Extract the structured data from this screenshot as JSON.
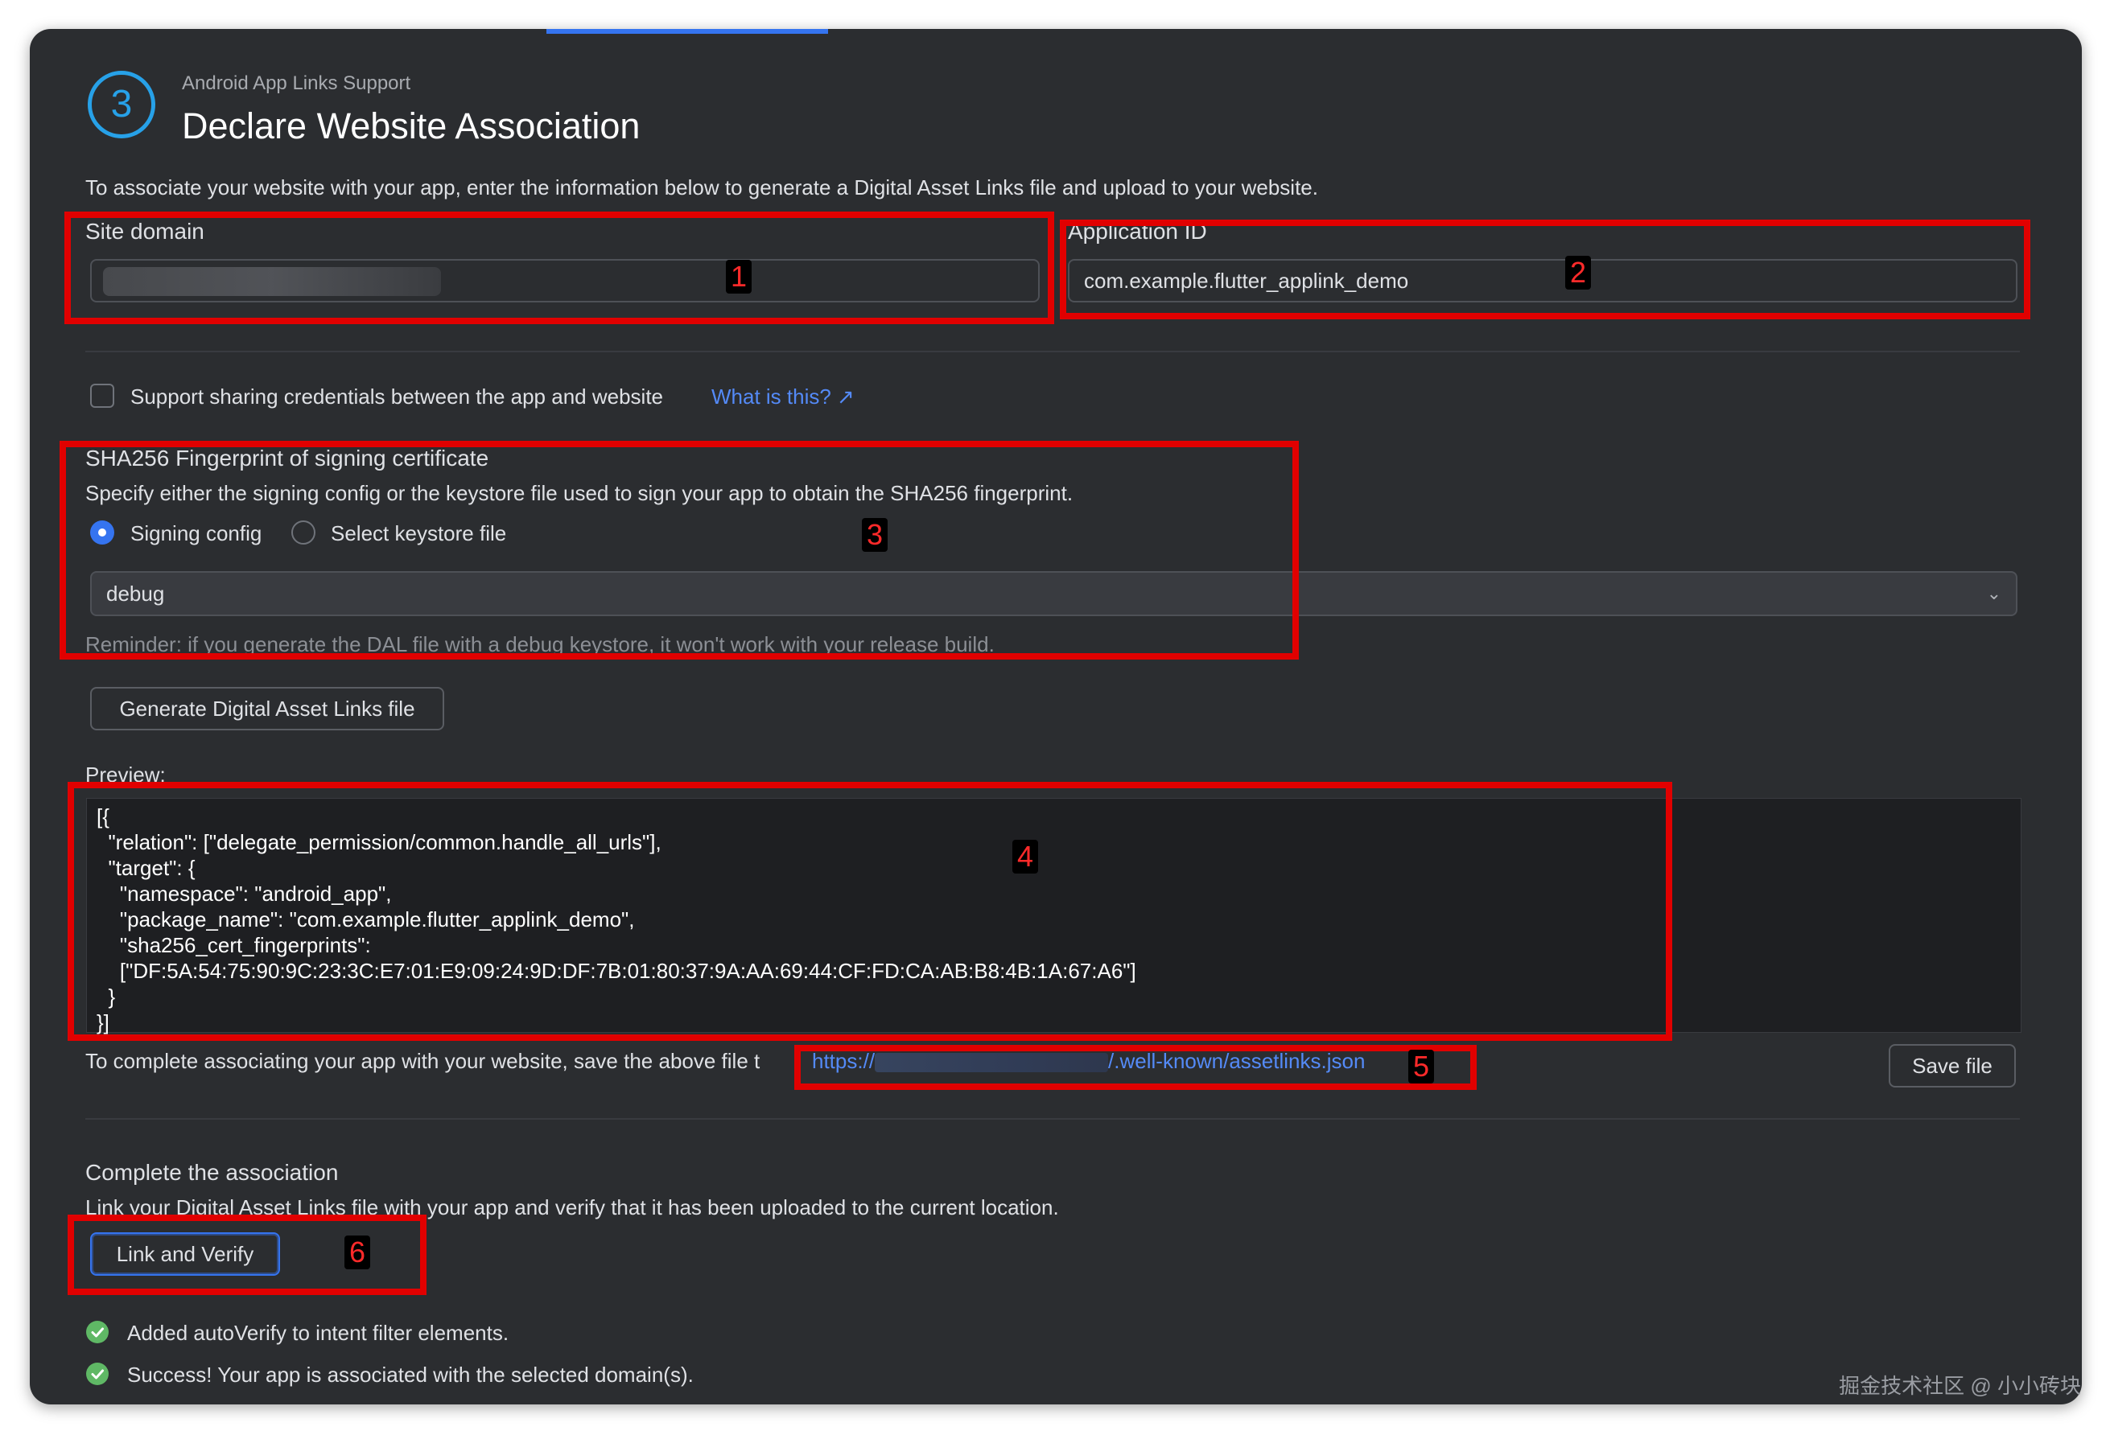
{
  "header": {
    "step_number": "3",
    "subtitle": "Android App Links Support",
    "title": "Declare Website Association",
    "description": "To associate your website with your app, enter the information below to generate a Digital Asset Links file and upload to your website."
  },
  "site_domain": {
    "label": "Site domain",
    "value": ""
  },
  "application_id": {
    "label": "Application ID",
    "value": "com.example.flutter_applink_demo"
  },
  "credentials": {
    "label": "Support sharing credentials between the app and website",
    "checked": false,
    "help_link": "What is this? ↗"
  },
  "fingerprint": {
    "title": "SHA256 Fingerprint of signing certificate",
    "description": "Specify either the signing config or the keystore file used to sign your app to obtain the SHA256 fingerprint.",
    "option_signing_config": "Signing config",
    "option_keystore": "Select keystore file",
    "selected_config": "debug",
    "reminder": "Reminder: if you generate the DAL file with a debug keystore, it won't work with your release build."
  },
  "generate_button": "Generate Digital Asset Links file",
  "preview": {
    "label": "Preview:",
    "content": "[{\n  \"relation\": [\"delegate_permission/common.handle_all_urls\"],\n  \"target\": {\n    \"namespace\": \"android_app\",\n    \"package_name\": \"com.example.flutter_applink_demo\",\n    \"sha256_cert_fingerprints\":\n    [\"DF:5A:54:75:90:9C:23:3C:E7:01:E9:09:24:9D:DF:7B:01:80:37:9A:AA:69:44:CF:FD:CA:AB:B8:4B:1A:67:A6\"]\n  }\n}]"
  },
  "save": {
    "text": "To complete associating your app with your website, save the above file t",
    "url_prefix": "https://",
    "url_suffix": "/.well-known/assetlinks.json",
    "button": "Save file"
  },
  "complete": {
    "title": "Complete the association",
    "description": "Link your Digital Asset Links file with your app and verify that it has been uploaded to the current location.",
    "button": "Link and Verify",
    "results": [
      "Added autoVerify to intent filter elements.",
      "Success! Your app is associated with the selected domain(s)."
    ]
  },
  "annotations": [
    "1",
    "2",
    "3",
    "4",
    "5",
    "6"
  ],
  "watermark": "掘金技术社区 @ 小小砖块",
  "colors": {
    "accent": "#3574f0",
    "link": "#548af7",
    "step": "#27a1e8",
    "success": "#5fb865",
    "annotation": "#e10000"
  }
}
